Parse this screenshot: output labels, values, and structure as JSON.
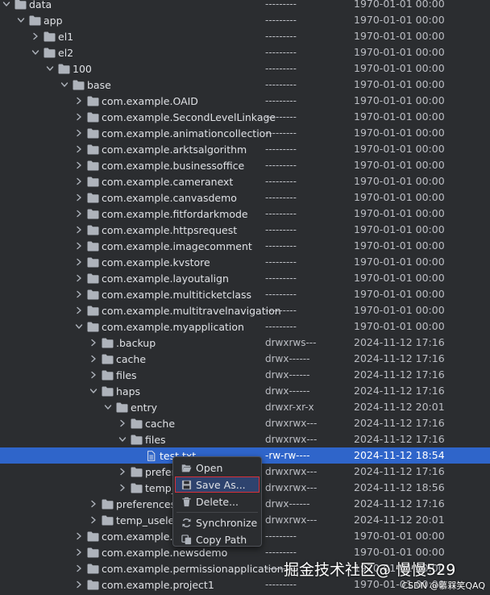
{
  "tree": [
    {
      "name": "data",
      "perm": "---------",
      "date": "1970-01-01 00:00",
      "depth": 0,
      "expanded": true,
      "kind": "folder"
    },
    {
      "name": "app",
      "perm": "---------",
      "date": "1970-01-01 00:00",
      "depth": 1,
      "expanded": true,
      "kind": "folder"
    },
    {
      "name": "el1",
      "perm": "---------",
      "date": "1970-01-01 00:00",
      "depth": 2,
      "expanded": false,
      "kind": "folder"
    },
    {
      "name": "el2",
      "perm": "---------",
      "date": "1970-01-01 00:00",
      "depth": 2,
      "expanded": true,
      "kind": "folder"
    },
    {
      "name": "100",
      "perm": "---------",
      "date": "1970-01-01 00:00",
      "depth": 3,
      "expanded": true,
      "kind": "folder"
    },
    {
      "name": "base",
      "perm": "---------",
      "date": "1970-01-01 00:00",
      "depth": 4,
      "expanded": true,
      "kind": "folder"
    },
    {
      "name": "com.example.OAID",
      "perm": "---------",
      "date": "1970-01-01 00:00",
      "depth": 5,
      "expanded": false,
      "kind": "folder"
    },
    {
      "name": "com.example.SecondLevelLinkage",
      "perm": "---------",
      "date": "1970-01-01 00:00",
      "depth": 5,
      "expanded": false,
      "kind": "folder"
    },
    {
      "name": "com.example.animationcollection",
      "perm": "---------",
      "date": "1970-01-01 00:00",
      "depth": 5,
      "expanded": false,
      "kind": "folder"
    },
    {
      "name": "com.example.arktsalgorithm",
      "perm": "---------",
      "date": "1970-01-01 00:00",
      "depth": 5,
      "expanded": false,
      "kind": "folder"
    },
    {
      "name": "com.example.businessoffice",
      "perm": "---------",
      "date": "1970-01-01 00:00",
      "depth": 5,
      "expanded": false,
      "kind": "folder"
    },
    {
      "name": "com.example.cameranext",
      "perm": "---------",
      "date": "1970-01-01 00:00",
      "depth": 5,
      "expanded": false,
      "kind": "folder"
    },
    {
      "name": "com.example.canvasdemo",
      "perm": "---------",
      "date": "1970-01-01 00:00",
      "depth": 5,
      "expanded": false,
      "kind": "folder"
    },
    {
      "name": "com.example.fitfordarkmode",
      "perm": "---------",
      "date": "1970-01-01 00:00",
      "depth": 5,
      "expanded": false,
      "kind": "folder"
    },
    {
      "name": "com.example.httpsrequest",
      "perm": "---------",
      "date": "1970-01-01 00:00",
      "depth": 5,
      "expanded": false,
      "kind": "folder"
    },
    {
      "name": "com.example.imagecomment",
      "perm": "---------",
      "date": "1970-01-01 00:00",
      "depth": 5,
      "expanded": false,
      "kind": "folder"
    },
    {
      "name": "com.example.kvstore",
      "perm": "---------",
      "date": "1970-01-01 00:00",
      "depth": 5,
      "expanded": false,
      "kind": "folder"
    },
    {
      "name": "com.example.layoutalign",
      "perm": "---------",
      "date": "1970-01-01 00:00",
      "depth": 5,
      "expanded": false,
      "kind": "folder"
    },
    {
      "name": "com.example.multiticketclass",
      "perm": "---------",
      "date": "1970-01-01 00:00",
      "depth": 5,
      "expanded": false,
      "kind": "folder"
    },
    {
      "name": "com.example.multitravelnavigation",
      "perm": "---------",
      "date": "1970-01-01 00:00",
      "depth": 5,
      "expanded": false,
      "kind": "folder"
    },
    {
      "name": "com.example.myapplication",
      "perm": "---------",
      "date": "1970-01-01 00:00",
      "depth": 5,
      "expanded": true,
      "kind": "folder"
    },
    {
      "name": ".backup",
      "perm": "drwxrws---",
      "date": "2024-11-12 17:16",
      "depth": 6,
      "expanded": false,
      "kind": "folder"
    },
    {
      "name": "cache",
      "perm": "drwx------",
      "date": "2024-11-12 17:16",
      "depth": 6,
      "expanded": false,
      "kind": "folder"
    },
    {
      "name": "files",
      "perm": "drwx------",
      "date": "2024-11-12 17:16",
      "depth": 6,
      "expanded": false,
      "kind": "folder"
    },
    {
      "name": "haps",
      "perm": "drwx------",
      "date": "2024-11-12 17:16",
      "depth": 6,
      "expanded": true,
      "kind": "folder"
    },
    {
      "name": "entry",
      "perm": "drwxr-xr-x",
      "date": "2024-11-12 20:01",
      "depth": 7,
      "expanded": true,
      "kind": "folder"
    },
    {
      "name": "cache",
      "perm": "drwxrwx---",
      "date": "2024-11-12 17:16",
      "depth": 8,
      "expanded": false,
      "kind": "folder"
    },
    {
      "name": "files",
      "perm": "drwxrwx---",
      "date": "2024-11-12 17:16",
      "depth": 8,
      "expanded": true,
      "kind": "folder"
    },
    {
      "name": "test.txt",
      "perm": "-rw-rw----",
      "date": "2024-11-12 18:54",
      "depth": 9,
      "expanded": false,
      "kind": "file",
      "selected": true
    },
    {
      "name": "preferences",
      "perm": "drwxrwx---",
      "date": "2024-11-12 17:16",
      "depth": 8,
      "expanded": false,
      "kind": "folder"
    },
    {
      "name": "temp_useless",
      "perm": "drwxrwx---",
      "date": "2024-11-12 18:56",
      "depth": 8,
      "expanded": false,
      "kind": "folder"
    },
    {
      "name": "preferences",
      "perm": "drwx------",
      "date": "2024-11-12 17:16",
      "depth": 6,
      "expanded": false,
      "kind": "folder"
    },
    {
      "name": "temp_useless",
      "perm": "drwxrwx---",
      "date": "2024-11-12 20:01",
      "depth": 6,
      "expanded": false,
      "kind": "folder"
    },
    {
      "name": "com.example.ne",
      "perm": "---------",
      "date": "1970-01-01 00:00",
      "depth": 5,
      "expanded": false,
      "kind": "folder"
    },
    {
      "name": "com.example.newsdemo",
      "perm": "---------",
      "date": "1970-01-01 00:00",
      "depth": 5,
      "expanded": false,
      "kind": "folder"
    },
    {
      "name": "com.example.permissionapplication",
      "perm": "---------",
      "date": "1970-01-01 00:00",
      "depth": 5,
      "expanded": false,
      "kind": "folder"
    },
    {
      "name": "com.example.project1",
      "perm": "---------",
      "date": "1970-01-01 00:00",
      "depth": 5,
      "expanded": false,
      "kind": "folder"
    }
  ],
  "context_menu": [
    {
      "label": "Open",
      "icon": "open-folder-icon"
    },
    {
      "label": "Save As...",
      "icon": "save-icon",
      "active": true
    },
    {
      "label": "Delete...",
      "icon": "delete-icon"
    },
    {
      "label": "Synchronize",
      "icon": "sync-icon",
      "separator_before": true
    },
    {
      "label": "Copy Path",
      "icon": "copy-icon"
    }
  ],
  "watermark": "掘金技术社区@ 慢慢529",
  "watermark_small": "CSDN @慕槑笑QAQ",
  "colors": {
    "background": "#2b2d30",
    "selection": "#2f65ca",
    "folder": "#aeb3bb",
    "menu_highlight_border": "#d8303a"
  }
}
